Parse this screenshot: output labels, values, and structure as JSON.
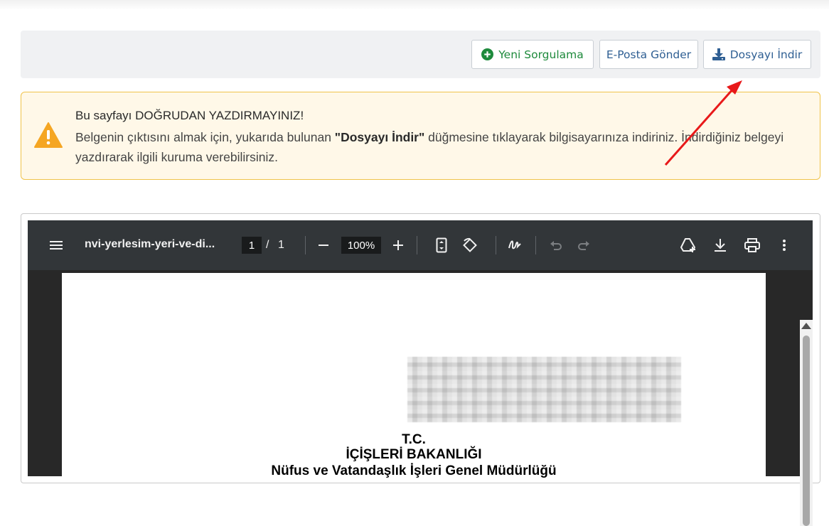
{
  "toolbar": {
    "new_query_label": "Yeni Sorgulama",
    "email_label": "E-Posta Gönder",
    "download_label": "Dosyayı İndir"
  },
  "alert": {
    "title": "Bu sayfayı DOĞRUDAN YAZDIRMAYINIZ!",
    "text_before": "Belgenin çıktısını almak için, yukarıda bulunan ",
    "text_bold": "\"Dosyayı İndir\"",
    "text_after": " düğmesine tıklayarak bilgisayarınıza indiriniz. İndirdiğiniz belgeyi yazdırarak ilgili kuruma verebilirsiniz.",
    "icon": "warning-icon"
  },
  "pdf_viewer": {
    "filename": "nvi-yerlesim-yeri-ve-di...",
    "current_page": "1",
    "page_separator": "/",
    "total_pages": "1",
    "zoom": "100%",
    "icons": [
      "menu-icon",
      "zoom-out-icon",
      "zoom-in-icon",
      "fit-page-icon",
      "rotate-icon",
      "draw-icon",
      "undo-icon",
      "redo-icon",
      "drive-icon",
      "download-icon",
      "print-icon",
      "more-icon"
    ]
  },
  "document": {
    "line1": "T.C.",
    "line2": "İÇİŞLERİ BAKANLIĞI",
    "line3": "Nüfus ve Vatandaşlık İşleri Genel Müdürlüğü"
  },
  "colors": {
    "green": "#1e8a3c",
    "blue": "#2f5f93",
    "alert_bg": "#fff8e8",
    "alert_border": "#f0c34a",
    "warning_orange": "#f5a623",
    "arrow_red": "#e8191a",
    "viewer_toolbar": "#323639"
  }
}
